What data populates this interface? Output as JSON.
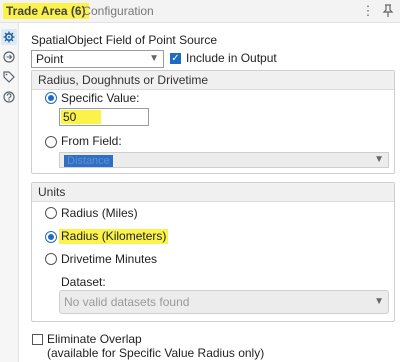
{
  "header": {
    "tool_name": "Trade Area (6)",
    "section": "- Configuration",
    "icons": {
      "more": "more-vertical-icon",
      "pin": "pin-icon"
    }
  },
  "sidebar": {
    "items": [
      {
        "icon": "gear-icon",
        "active": true
      },
      {
        "icon": "connection-icon",
        "active": false
      },
      {
        "icon": "tag-icon",
        "active": false
      },
      {
        "icon": "help-icon",
        "active": false
      }
    ]
  },
  "source": {
    "label": "SpatialObject Field of Point Source",
    "selected": "Point",
    "include_label": "Include in Output",
    "include_checked": true
  },
  "radius_group": {
    "title": "Radius, Doughnuts or Drivetime",
    "specific_label": "Specific Value:",
    "specific_value": "50",
    "from_field_label": "From Field:",
    "from_field_value": "Distance",
    "selected": "specific"
  },
  "units": {
    "title": "Units",
    "options": [
      "Radius (Miles)",
      "Radius (Kilometers)",
      "Drivetime Minutes"
    ],
    "selected_index": 1,
    "dataset_label": "Dataset:",
    "dataset_placeholder": "No valid datasets found"
  },
  "overlap": {
    "label": "Eliminate Overlap",
    "note": "(available for Specific Value Radius only)",
    "checked": false
  },
  "colors": {
    "accent": "#1e6bc4",
    "highlight": "#fbf24a"
  }
}
